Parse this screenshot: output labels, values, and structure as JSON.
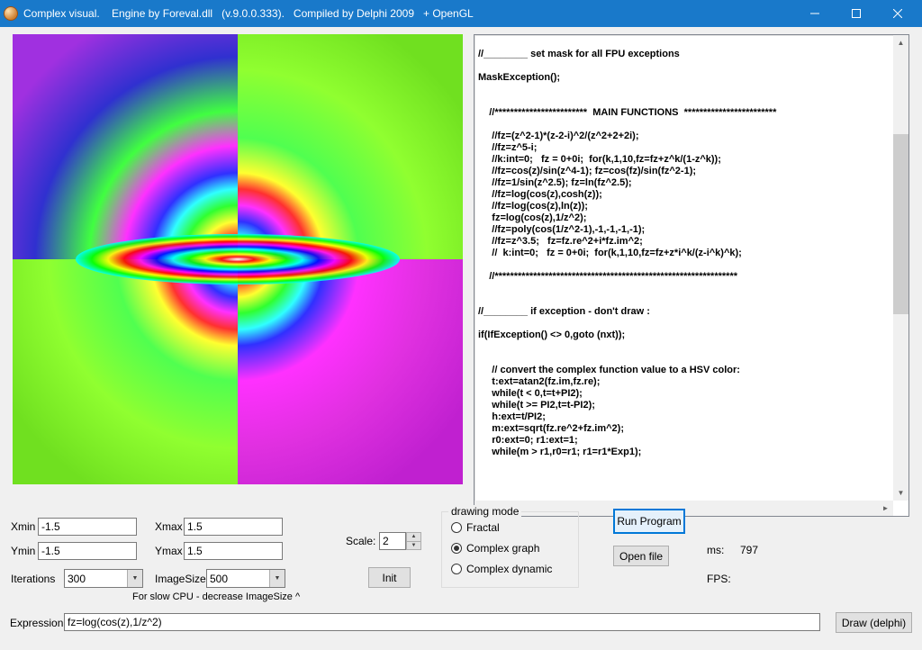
{
  "window": {
    "title": "Complex visual.    Engine by Foreval.dll   (v.9.0.0.333).   Compiled by Delphi 2009   + OpenGL"
  },
  "bounds": {
    "xmin_label": "Xmin",
    "xmin": "-1.5",
    "xmax_label": "Xmax",
    "xmax": "1.5",
    "ymin_label": "Ymin",
    "ymin": "-1.5",
    "ymax_label": "Ymax",
    "ymax": "1.5"
  },
  "iter": {
    "label": "Iterations",
    "value": "300",
    "imgsize_label": "ImageSize:",
    "imgsize": "500",
    "hint": "For slow CPU - decrease ImageSize ^"
  },
  "scale": {
    "label": "Scale:",
    "value": "2"
  },
  "init_btn": "Init",
  "drawing": {
    "legend": "drawing mode",
    "r1": "Fractal",
    "r2": "Complex graph",
    "r3": "Complex dynamic"
  },
  "run_btn": "Run Program",
  "open_btn": "Open file",
  "ms_label": "ms:",
  "ms_value": "797",
  "fps_label": "FPS:",
  "expr_label": "Expression:",
  "expr_value": "fz=log(cos(z),1/z^2)",
  "draw_btn": "Draw  (delphi)",
  "code": "\n//________ set mask for all FPU exceptions\n\nMaskException();\n\n\n    //************************  MAIN FUNCTIONS  ************************\n\n     //fz=(z^2-1)*(z-2-i)^2/(z^2+2+2i);\n     //fz=z^5-i;\n     //k:int=0;   fz = 0+0i;  for(k,1,10,fz=fz+z^k/(1-z^k));\n     //fz=cos(z)/sin(z^4-1); fz=cos(fz)/sin(fz^2-1);\n     //fz=1/sin(z^2.5); fz=ln(fz^2.5);\n     //fz=log(cos(z),cosh(z));\n     //fz=log(cos(z),ln(z));\n     fz=log(cos(z),1/z^2);\n     //fz=poly(cos(1/z^2-1),-1,-1,-1,-1);\n     //fz=z^3.5;   fz=fz.re^2+i*fz.im^2;\n     //  k:int=0;   fz = 0+0i;  for(k,1,10,fz=fz+z*i^k/(z-i^k)^k);\n\n    //***************************************************************\n\n\n//________ if exception - don't draw :\n\nif(IfException() <> 0,goto (nxt));\n\n\n     // convert the complex function value to a HSV color:\n     t:ext=atan2(fz.im,fz.re);\n     while(t < 0,t=t+PI2);\n     while(t >= PI2,t=t-PI2);\n     h:ext=t/PI2;\n     m:ext=sqrt(fz.re^2+fz.im^2);\n     r0:ext=0; r1:ext=1;\n     while(m > r1,r0=r1; r1=r1*Exp1);"
}
